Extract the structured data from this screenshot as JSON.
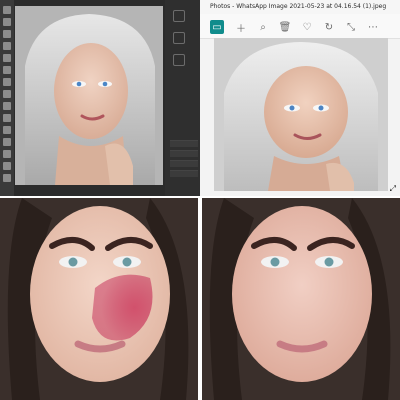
{
  "photos_viewer": {
    "title": "Photos - WhatsApp Image 2021-05-23 at 04.16.54 (1).jpeg"
  },
  "icons": {
    "active_tool": "photo-icon",
    "toolbar": [
      "plus-icon",
      "zoom-in-icon",
      "delete-icon",
      "heart-icon",
      "rotate-icon",
      "crop-icon",
      "more-icon"
    ]
  },
  "colors": {
    "photoshop_bg": "#2b2b2b",
    "photos_accent": "#108c8c"
  }
}
